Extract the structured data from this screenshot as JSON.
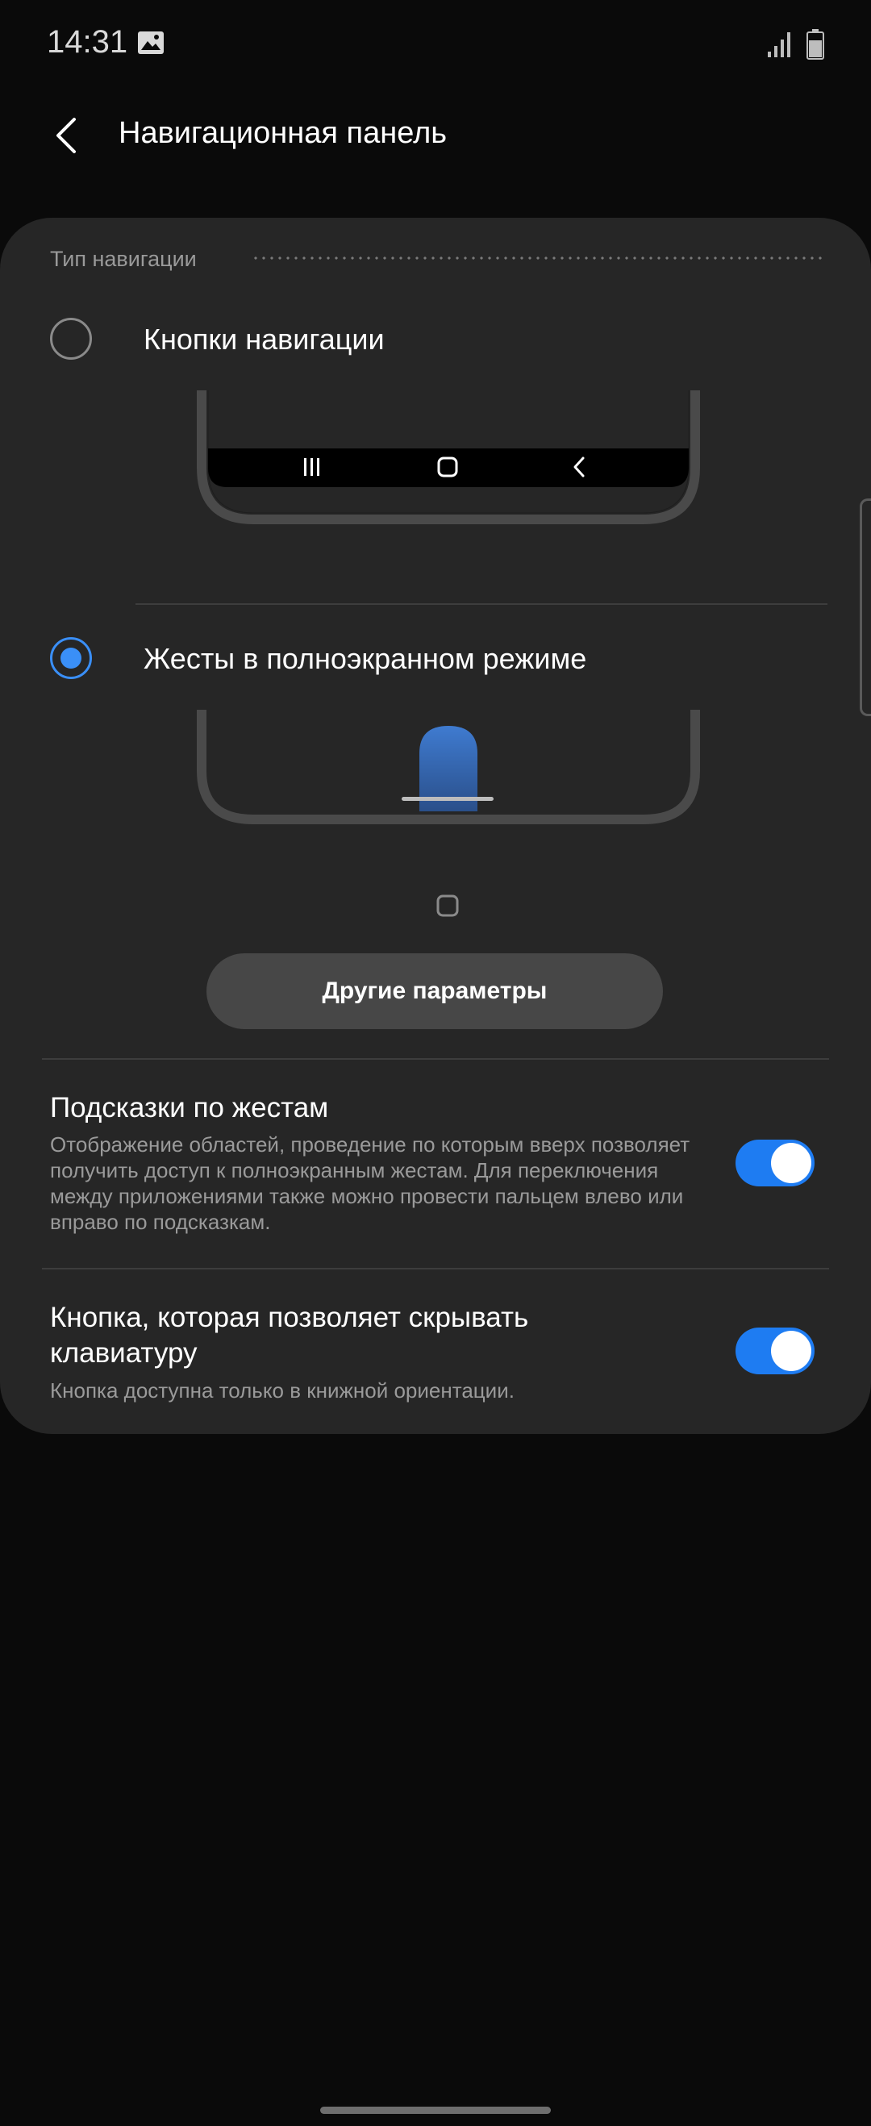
{
  "status_bar": {
    "time": "14:31",
    "icons": [
      "gallery-icon",
      "signal-icon",
      "battery-icon"
    ]
  },
  "header": {
    "title": "Навигационная панель",
    "back_icon": "chevron-left-icon"
  },
  "navigation_type": {
    "section_label": "Тип навигации",
    "options": [
      {
        "label": "Кнопки навигации",
        "selected": false,
        "illustration_icons": [
          "recents-icon",
          "home-icon",
          "back-icon"
        ]
      },
      {
        "label": "Жесты в полноэкранном режиме",
        "selected": true,
        "illustration_icons": [
          "gesture-swipe-icon",
          "home-square-icon"
        ]
      }
    ],
    "more_button_label": "Другие параметры"
  },
  "settings": [
    {
      "title": "Подсказки по жестам",
      "description": "Отображение областей, проведение по которым вверх позволяет получить доступ к полноэкранным жестам. Для переключения между приложениями также можно провести пальцем влево или вправо по подсказкам.",
      "enabled": true
    },
    {
      "title": "Кнопка, которая позволяет скрывать клавиатуру",
      "description": "Кнопка доступна только в книжной ориентации.",
      "enabled": true
    }
  ],
  "colors": {
    "accent": "#1e7cf2",
    "radio_selected": "#3a8ff7",
    "card_background": "#262626",
    "page_background": "#0a0a0a"
  }
}
